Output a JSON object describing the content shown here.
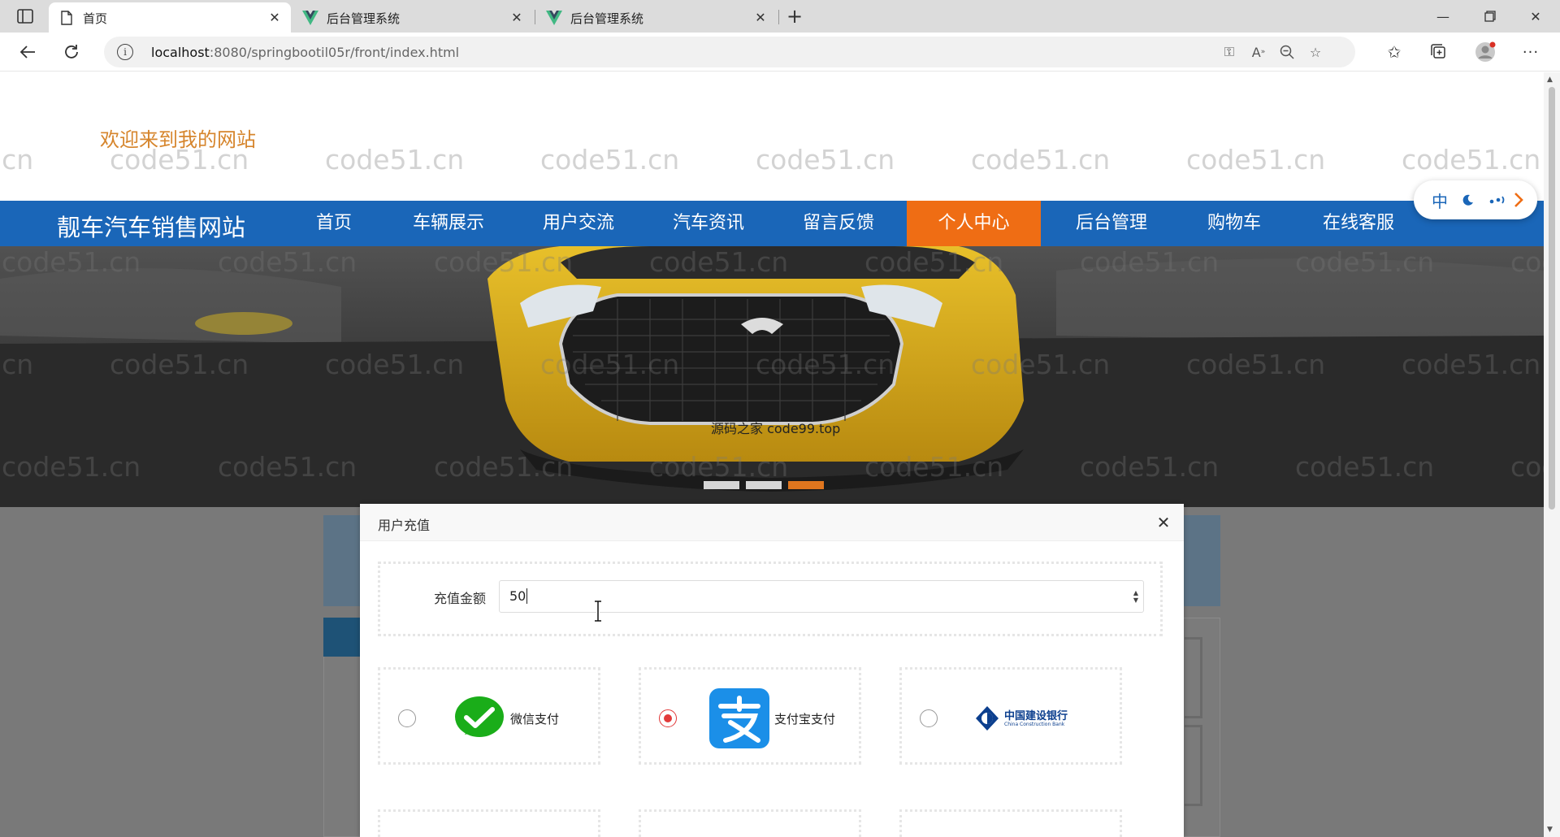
{
  "browser": {
    "tabs": [
      {
        "title": "首页",
        "icon": "page-icon",
        "active": true
      },
      {
        "title": "后台管理系统",
        "icon": "vue-logo-icon",
        "active": false
      },
      {
        "title": "后台管理系统",
        "icon": "vue-logo-icon",
        "active": false
      }
    ],
    "url_host": "localhost",
    "url_path": ":8080/springbootil05r/front/index.html"
  },
  "site": {
    "welcome": "欢迎来到我的网站",
    "title": "靓车汽车销售网站",
    "nav": [
      {
        "label": "首页",
        "active": false
      },
      {
        "label": "车辆展示",
        "active": false
      },
      {
        "label": "用户交流",
        "active": false
      },
      {
        "label": "汽车资讯",
        "active": false
      },
      {
        "label": "留言反馈",
        "active": false
      },
      {
        "label": "个人中心",
        "active": true
      },
      {
        "label": "后台管理",
        "active": false
      },
      {
        "label": "购物车",
        "active": false
      },
      {
        "label": "在线客服",
        "active": false
      }
    ],
    "lang_widget": {
      "lang": "中",
      "moon": "moon-icon",
      "dots": "dots-icon",
      "arrow": "chevron-right-icon"
    },
    "banner": {
      "caption": "源码之家 code99.top",
      "slides": 3,
      "active_slide": 3
    }
  },
  "watermark": "code51.cn",
  "dialog": {
    "title": "用户充值",
    "amount_label": "充值金额",
    "amount_value": "50",
    "payment_methods": [
      {
        "label": "微信支付",
        "icon": "wechat-pay-icon",
        "selected": false
      },
      {
        "label": "支付宝支付",
        "icon": "alipay-icon",
        "selected": true
      },
      {
        "label": "中国建设银行",
        "sub": "China Construction Bank",
        "icon": "ccb-logo-icon",
        "selected": false
      }
    ]
  },
  "colors": {
    "nav_bg": "#1a66b8",
    "nav_active": "#ef6d14",
    "welcome": "#d6852c",
    "radio_selected": "#e23a3a",
    "wechat_green": "#1aad19",
    "alipay_blue": "#1b8fe8",
    "ccb_blue": "#0c3f8e"
  }
}
